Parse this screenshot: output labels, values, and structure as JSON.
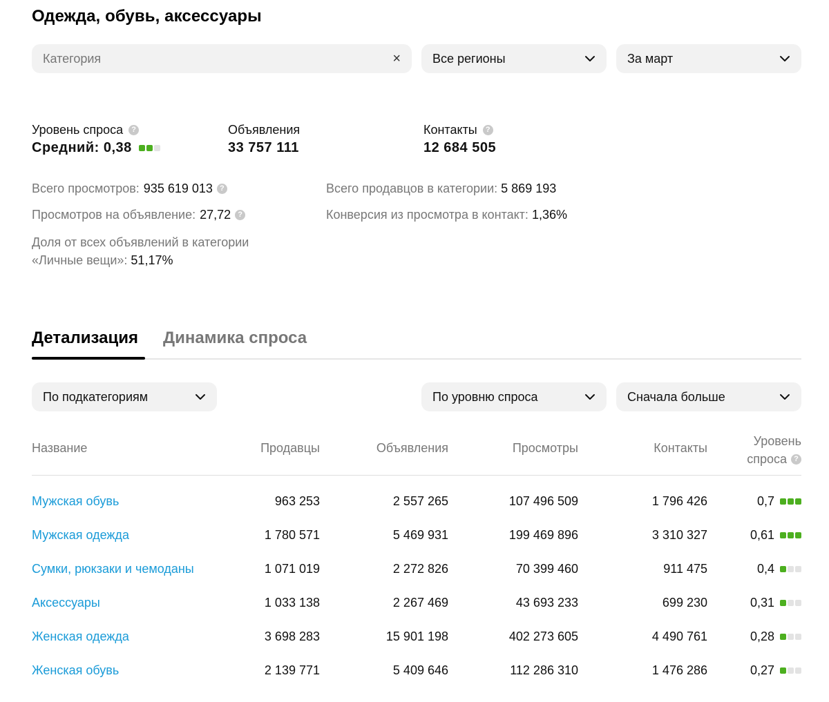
{
  "header": {
    "title": "Одежда, обувь, аксессуары"
  },
  "filters": {
    "category_placeholder": "Категория",
    "region": "Все регионы",
    "period": "За март",
    "clear_symbol": "×"
  },
  "stats": {
    "demand": {
      "label": "Уровень спроса",
      "value": "Средний: 0,38",
      "level": 2,
      "max_level": 3
    },
    "ads": {
      "label": "Объявления",
      "value": "33 757 111"
    },
    "contacts": {
      "label": "Контакты",
      "value": "12 684 505"
    }
  },
  "meta": {
    "total_views_label": "Всего просмотров:",
    "total_views": "935 619 013",
    "views_per_ad_label": "Просмотров на объявление:",
    "views_per_ad": "27,72",
    "share_label_line1": "Доля от всех объявлений в категории",
    "share_label_line2": "«Личные вещи»:",
    "share": "51,17%",
    "sellers_label": "Всего продавцов в категории:",
    "sellers": "5 869 193",
    "conversion_label": "Конверсия из просмотра в контакт:",
    "conversion": "1,36%"
  },
  "tabs": [
    {
      "label": "Детализация",
      "active": true
    },
    {
      "label": "Динамика спроса",
      "active": false
    }
  ],
  "table_controls": {
    "group_by": "По подкатегориям",
    "sort_by": "По уровню спроса",
    "order": "Сначала больше"
  },
  "table": {
    "headers": {
      "name": "Название",
      "sellers": "Продавцы",
      "ads": "Объявления",
      "views": "Просмотры",
      "contacts": "Контакты",
      "demand_line1": "Уровень",
      "demand_line2": "спроса"
    },
    "rows": [
      {
        "name": "Мужская обувь",
        "sellers": "963 253",
        "ads": "2 557 265",
        "views": "107 496 509",
        "contacts": "1 796 426",
        "demand": "0,7",
        "level": 3
      },
      {
        "name": "Мужская одежда",
        "sellers": "1 780 571",
        "ads": "5 469 931",
        "views": "199 469 896",
        "contacts": "3 310 327",
        "demand": "0,61",
        "level": 3
      },
      {
        "name": "Сумки, рюкзаки и чемоданы",
        "sellers": "1 071 019",
        "ads": "2 272 826",
        "views": "70 399 460",
        "contacts": "911 475",
        "demand": "0,4",
        "level": 1
      },
      {
        "name": "Аксессуары",
        "sellers": "1 033 138",
        "ads": "2 267 469",
        "views": "43 693 233",
        "contacts": "699 230",
        "demand": "0,31",
        "level": 1
      },
      {
        "name": "Женская одежда",
        "sellers": "3 698 283",
        "ads": "15 901 198",
        "views": "402 273 605",
        "contacts": "4 490 761",
        "demand": "0,28",
        "level": 1
      },
      {
        "name": "Женская обувь",
        "sellers": "2 139 771",
        "ads": "5 409 646",
        "views": "112 286 310",
        "contacts": "1 476 286",
        "demand": "0,27",
        "level": 1
      }
    ]
  },
  "colors": {
    "accent_link": "#1a9bd8",
    "demand_on": "#4caf1f",
    "demand_off": "#e3e3e3"
  }
}
